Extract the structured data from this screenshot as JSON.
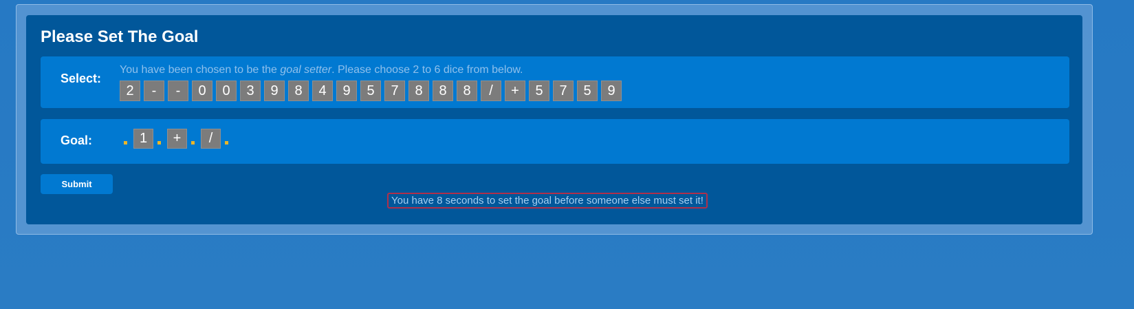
{
  "panel": {
    "title": "Please Set The Goal"
  },
  "select": {
    "label": "Select:",
    "instruction_prefix": "You have been chosen to be the ",
    "instruction_emphasis": "goal setter",
    "instruction_suffix": ". Please choose 2 to 6 dice from below.",
    "dice": [
      "2",
      "-",
      "-",
      "0",
      "0",
      "3",
      "9",
      "8",
      "4",
      "9",
      "5",
      "7",
      "8",
      "8",
      "8",
      "/",
      "+",
      "5",
      "7",
      "5",
      "9"
    ]
  },
  "goal": {
    "label": "Goal:",
    "dice": [
      "1",
      "+",
      "/"
    ]
  },
  "submit": {
    "label": "Submit"
  },
  "status": {
    "message": "You have 8 seconds to set the goal before someone else must set it!"
  },
  "colors": {
    "panel_bg": "#01579a",
    "row_bg": "#01579a",
    "die_bg": "#7c7c7c",
    "slot_dot": "#e8b52a",
    "timer_border": "#b0304a"
  }
}
